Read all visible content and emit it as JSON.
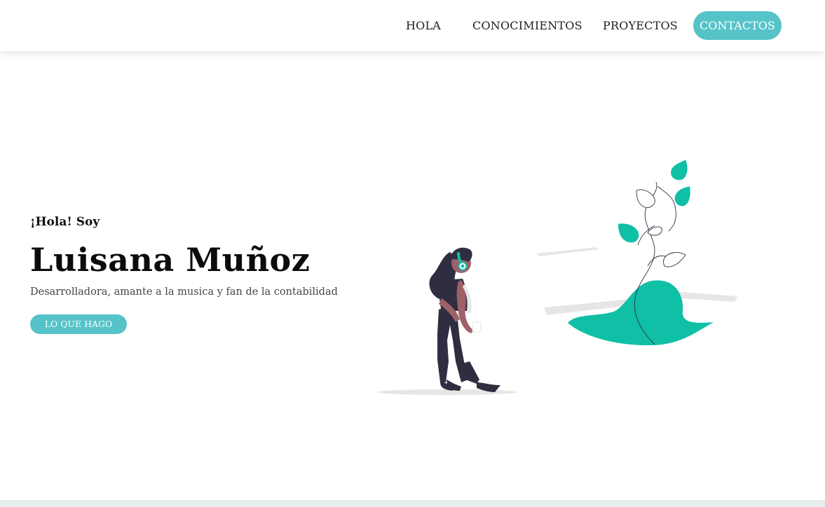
{
  "nav": {
    "items": [
      "HOLA",
      "CONOCIMIENTOS",
      "PROYECTOS"
    ],
    "contact_label": "CONTACTOS"
  },
  "hero": {
    "greeting": "¡Hola! Soy",
    "name": "Luisana Muñoz",
    "tagline": "Desarrolladora, amante a la musica y fan de la contabilidad",
    "cta_label": "LO QUE HAGO"
  },
  "illustration": {
    "icon": "woman-with-headphones-and-plant-icon"
  },
  "colors": {
    "accent": "#56c3c9",
    "illustration_teal": "#0fbfa6",
    "figure_dark": "#2f2e41",
    "skin": "#9e616a"
  }
}
